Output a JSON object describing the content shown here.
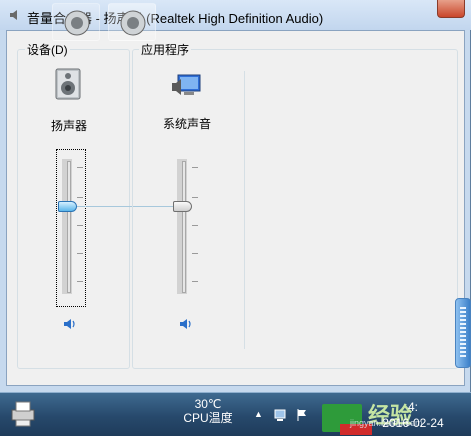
{
  "window": {
    "title": "音量合成器 - 扬声器 (Realtek High Definition Audio)"
  },
  "groups": {
    "device": {
      "label": "设备(D)",
      "device_name": "扬声器",
      "volume": 0.68,
      "icon": "speaker-device-icon"
    },
    "applications": {
      "label": "应用程序",
      "items": [
        {
          "name": "系统声音",
          "volume": 0.68,
          "icon": "system-sounds-icon"
        }
      ]
    }
  },
  "taskbar": {
    "temperature": "30℃",
    "temperature_label": "CPU温度",
    "date": "2016-02-24",
    "time_fragment": "4:",
    "watermark": "经验",
    "watermark_sub": "jingyan.baidu.com"
  },
  "colors": {
    "window_frame": "#c6d9ee",
    "client_bg": "#f0f0f0",
    "active_thumb": "#5bb6ea",
    "taskbar": "#27496c"
  }
}
